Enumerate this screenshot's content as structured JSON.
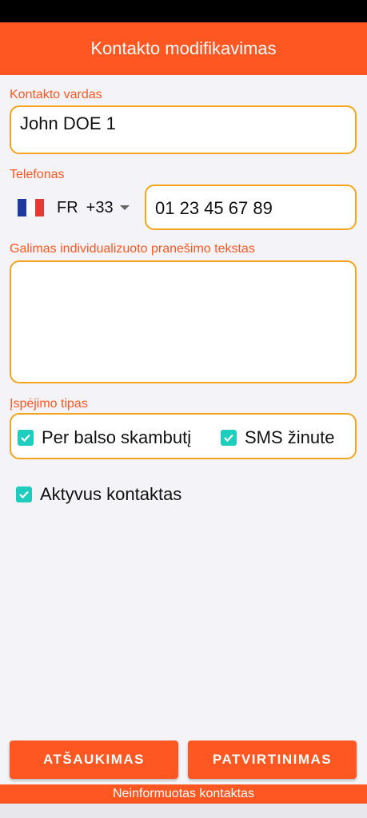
{
  "header": {
    "title": "Kontakto modifikavimas"
  },
  "contact_name": {
    "label": "Kontakto vardas",
    "value": "John DOE 1"
  },
  "phone": {
    "label": "Telefonas",
    "country_code": "FR",
    "dial_code": "+33",
    "flag_icon": "france-flag-icon",
    "number": "01 23 45 67 89"
  },
  "message": {
    "label": "Galimas individualizuoto pranešimo tekstas",
    "value": ""
  },
  "alert_type": {
    "label": "Įspėjimo tipas",
    "options": [
      {
        "label": "Per balso skambutį",
        "checked": true
      },
      {
        "label": "SMS žinute",
        "checked": true
      }
    ]
  },
  "active_contact": {
    "label": "Aktyvus kontaktas",
    "checked": true
  },
  "buttons": {
    "cancel": "ATŠAUKIMAS",
    "confirm": "PATVIRTINIMAS"
  },
  "footer": {
    "status": "Neinformuotas kontaktas"
  },
  "colors": {
    "accent": "#ff5722",
    "field_border": "#f3a51b",
    "checkbox": "#1ecdbd"
  }
}
